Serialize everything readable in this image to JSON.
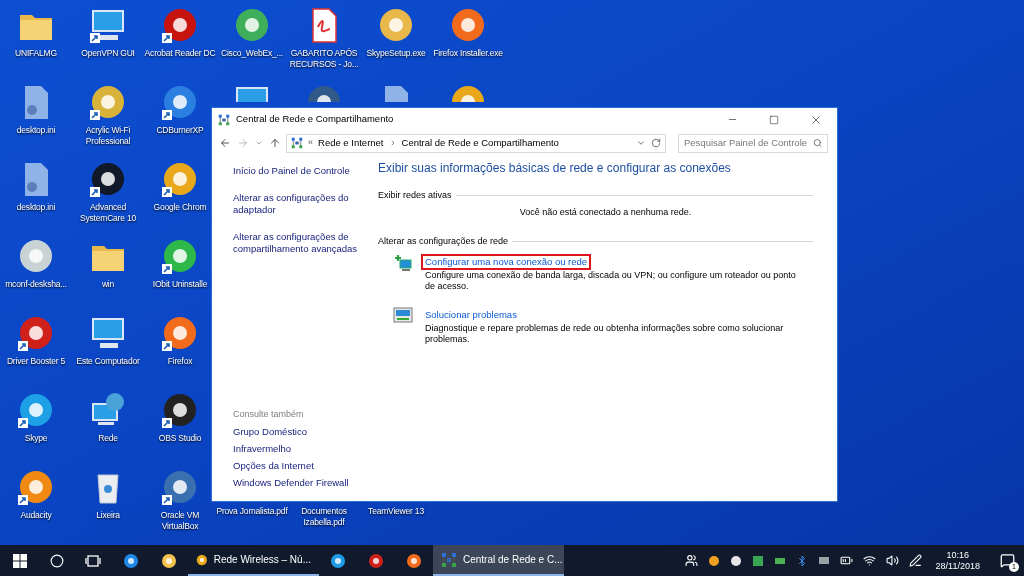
{
  "desktop": {
    "columns": [
      {
        "top": [
          {
            "label": "UNIFALMG",
            "kind": "folder",
            "shortcut": false
          },
          {
            "label": "desktop.ini",
            "kind": "file",
            "shortcut": false
          },
          {
            "label": "desktop.ini",
            "kind": "file",
            "shortcut": false
          },
          {
            "label": "mconf-desksha...",
            "kind": "app",
            "color": "#c9d3d6",
            "shortcut": false
          },
          {
            "label": "Driver Booster 5",
            "kind": "app",
            "color": "#d0201a",
            "shortcut": true
          },
          {
            "label": "Skype",
            "kind": "app",
            "color": "#1ea0e6",
            "shortcut": true
          },
          {
            "label": "Audacity",
            "kind": "app",
            "color": "#f08a12",
            "shortcut": true
          }
        ]
      },
      {
        "top": [
          {
            "label": "OpenVPN GUI",
            "kind": "computer",
            "shortcut": true
          },
          {
            "label": "Acrylic Wi-Fi Professional",
            "kind": "app",
            "color": "#d9b23a",
            "shortcut": true
          },
          {
            "label": "Advanced SystemCare 10",
            "kind": "app",
            "color": "#111827",
            "shortcut": true
          },
          {
            "label": "win",
            "kind": "folder",
            "shortcut": false
          },
          {
            "label": "Este Computador",
            "kind": "computer",
            "shortcut": false
          },
          {
            "label": "Rede",
            "kind": "globe",
            "shortcut": false
          },
          {
            "label": "Lixeira",
            "kind": "trash",
            "shortcut": false
          }
        ]
      },
      {
        "top": [
          {
            "label": "Acrobat Reader DC",
            "kind": "app",
            "color": "#c8140e",
            "shortcut": true
          },
          {
            "label": "CDBurnerXP",
            "kind": "app",
            "color": "#2a7fe0",
            "shortcut": true
          },
          {
            "label": "Google Chrom",
            "kind": "app",
            "color": "#e8a81a",
            "shortcut": true
          },
          {
            "label": "IObit Uninstalle",
            "kind": "app",
            "color": "#2eb84a",
            "shortcut": true
          },
          {
            "label": "Firefox",
            "kind": "app",
            "color": "#f26a1b",
            "shortcut": true
          },
          {
            "label": "OBS Studio",
            "kind": "app",
            "color": "#222222",
            "shortcut": true
          },
          {
            "label": "Oracle VM VirtualBox",
            "kind": "app",
            "color": "#3a6fb0",
            "shortcut": true
          }
        ]
      },
      {
        "top": [
          {
            "label": "Cisco_WebEx_...",
            "kind": "app",
            "color": "#3fae5a",
            "shortcut": false
          },
          {
            "kind": "computer"
          }
        ],
        "bottom": [
          {
            "label": "Prova Jornalista.pdf"
          }
        ]
      },
      {
        "top": [
          {
            "label": "GABARITO APÓS RECURSOS - Jo...",
            "kind": "pdf",
            "shortcut": false
          },
          {
            "kind": "app",
            "color": "#2f5a8a"
          }
        ],
        "bottom": [
          {
            "label": "Documentos Izabella.pdf"
          }
        ]
      },
      {
        "top": [
          {
            "label": "SkypeSetup.exe",
            "kind": "app",
            "color": "#e8b84a",
            "shortcut": false
          },
          {
            "kind": "file"
          }
        ],
        "bottom": [
          {
            "label": "TeamViewer 13"
          }
        ]
      },
      {
        "top": [
          {
            "label": "Firefox Installer.exe",
            "kind": "app",
            "color": "#f26a1b",
            "shortcut": false
          },
          {
            "kind": "app",
            "color": "#e8a81a"
          }
        ]
      }
    ]
  },
  "window": {
    "title": "Central de Rede e Compartilhamento",
    "breadcrumb": {
      "prefix": "«",
      "items": [
        "Rede e Internet",
        "Central de Rede e Compartilhamento"
      ]
    },
    "search": {
      "placeholder": "Pesquisar Painel de Controle"
    },
    "sidebar": {
      "links": [
        "Início do Painel de Controle",
        "Alterar as configurações do adaptador",
        "Alterar as configurações de compartilhamento avançadas"
      ],
      "see_also": {
        "heading": "Consulte também",
        "links": [
          "Grupo Doméstico",
          "Infravermelho",
          "Opções da Internet",
          "Windows Defender Firewall"
        ]
      }
    },
    "heading": "Exibir suas informações básicas de rede e configurar as conexões",
    "active_networks": {
      "heading": "Exibir redes ativas",
      "message": "Você não está conectado a nenhuma rede."
    },
    "change_settings": {
      "heading": "Alterar as configurações de rede",
      "tasks": [
        {
          "kind": "setup",
          "link": "Configurar uma nova conexão ou rede",
          "description": "Configure uma conexão de banda larga, discada ou VPN; ou configure um roteador ou ponto de acesso.",
          "highlighted": true
        },
        {
          "kind": "troubleshoot",
          "link": "Solucionar problemas",
          "description": "Diagnostique e repare problemas de rede ou obtenha informações sobre como solucionar problemas.",
          "highlighted": false
        }
      ]
    }
  },
  "taskbar": {
    "items": [
      {
        "kind": "start",
        "selected": false
      },
      {
        "kind": "search",
        "selected": false
      },
      {
        "kind": "task_view",
        "selected": false
      },
      {
        "kind": "app",
        "color": "#1e88e5",
        "selected": false
      },
      {
        "kind": "app",
        "color": "#f2c14e",
        "selected": false
      },
      {
        "kind": "app",
        "color": "#e8a81a",
        "label": "Rede Wireless – Nú...",
        "selected": false
      },
      {
        "kind": "app",
        "color": "#1e9be6",
        "selected": false
      },
      {
        "kind": "app",
        "color": "#d0201a",
        "selected": false
      },
      {
        "kind": "app",
        "color": "#f26a1b",
        "selected": false
      },
      {
        "kind": "network",
        "label": "Central de Rede e C...",
        "selected": true
      }
    ],
    "time": "10:16",
    "date": "28/11/2018",
    "notifications": "1"
  }
}
